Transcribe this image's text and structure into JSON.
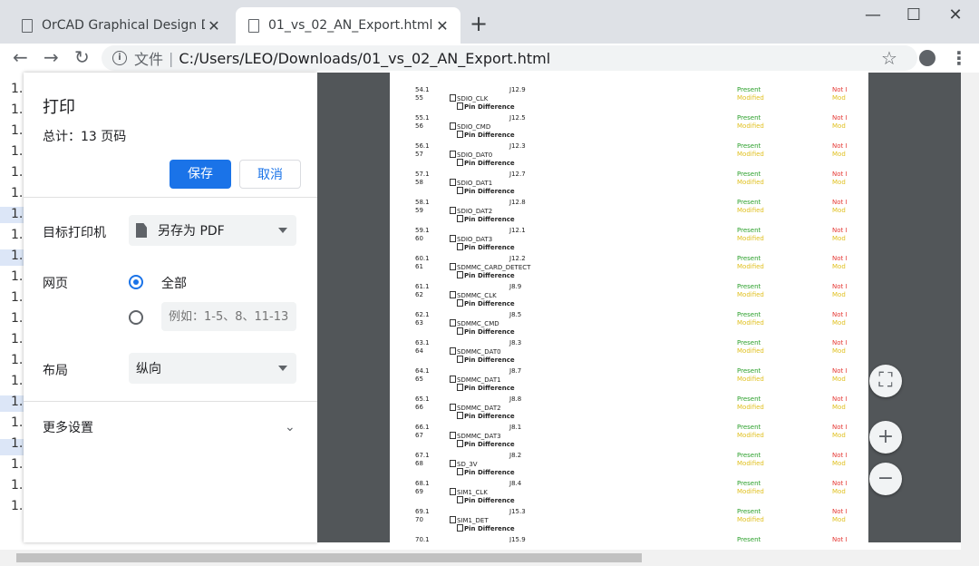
{
  "tabs": [
    {
      "label": "OrCAD Graphical Design Differ",
      "close": "✕"
    },
    {
      "label": "01_vs_02_AN_Export.html",
      "close": "✕"
    }
  ],
  "new_tab": "+",
  "window": {
    "minimize": "—",
    "maximize": "☐",
    "close": "✕"
  },
  "nav": {
    "back": "←",
    "forward": "→",
    "reload": "↻"
  },
  "address": {
    "site_label": "文件",
    "separator": "|",
    "url": "C:/Users/LEO/Downloads/01_vs_02_AN_Export.html"
  },
  "background_rows": [
    "1.",
    "1.",
    "1.",
    "1.",
    "1.",
    "1.",
    "1.",
    "1.",
    "1.",
    "1.",
    "1.",
    "1.",
    "1.",
    "1.",
    "1.",
    "1.",
    "1.",
    "1.",
    "1.",
    "1.",
    "1."
  ],
  "print": {
    "title": "打印",
    "total": "总计：13 页码",
    "save": "保存",
    "cancel": "取消",
    "destination_label": "目标打印机",
    "destination_value": "另存为 PDF",
    "pages_label": "网页",
    "pages_all": "全部",
    "pages_custom_placeholder": "例如：1-5、8、11-13",
    "layout_label": "布局",
    "layout_value": "纵向",
    "more_settings": "更多设置",
    "more_caret": "⌄"
  },
  "preview_rows": [
    {
      "idx1": "54.1",
      "idx2": "55",
      "ref": "J12.9",
      "net": "SDIO_CLK"
    },
    {
      "idx1": "55.1",
      "idx2": "56",
      "ref": "J12.5",
      "net": "SDIO_CMD"
    },
    {
      "idx1": "56.1",
      "idx2": "57",
      "ref": "J12.3",
      "net": "SDIO_DAT0"
    },
    {
      "idx1": "57.1",
      "idx2": "58",
      "ref": "J12.7",
      "net": "SDIO_DAT1"
    },
    {
      "idx1": "58.1",
      "idx2": "59",
      "ref": "J12.8",
      "net": "SDIO_DAT2"
    },
    {
      "idx1": "59.1",
      "idx2": "60",
      "ref": "J12.1",
      "net": "SDIO_DAT3"
    },
    {
      "idx1": "60.1",
      "idx2": "61",
      "ref": "J12.2",
      "net": "SDMMC_CARD_DETECT"
    },
    {
      "idx1": "61.1",
      "idx2": "62",
      "ref": "J8.9",
      "net": "SDMMC_CLK"
    },
    {
      "idx1": "62.1",
      "idx2": "63",
      "ref": "J8.5",
      "net": "SDMMC_CMD"
    },
    {
      "idx1": "63.1",
      "idx2": "64",
      "ref": "J8.3",
      "net": "SDMMC_DAT0"
    },
    {
      "idx1": "64.1",
      "idx2": "65",
      "ref": "J8.7",
      "net": "SDMMC_DAT1"
    },
    {
      "idx1": "65.1",
      "idx2": "66",
      "ref": "J8.8",
      "net": "SDMMC_DAT2"
    },
    {
      "idx1": "66.1",
      "idx2": "67",
      "ref": "J8.1",
      "net": "SDMMC_DAT3"
    },
    {
      "idx1": "67.1",
      "idx2": "68",
      "ref": "J8.2",
      "net": "SD_3V"
    },
    {
      "idx1": "68.1",
      "idx2": "69",
      "ref": "J8.4",
      "net": "SIM1_CLK"
    },
    {
      "idx1": "69.1",
      "idx2": "70",
      "ref": "J15.3",
      "net": "SIM1_DET"
    },
    {
      "idx1": "70.1",
      "idx2": "",
      "ref": "J15.9",
      "net": ""
    }
  ],
  "preview_text": {
    "pin_diff": "Pin Difference",
    "present": "Present",
    "modified": "Modified",
    "not": "Not I",
    "mod_short": "Mod"
  },
  "preview_controls": {
    "fit": "⛶",
    "zoom_in": "+",
    "zoom_out": "−"
  }
}
